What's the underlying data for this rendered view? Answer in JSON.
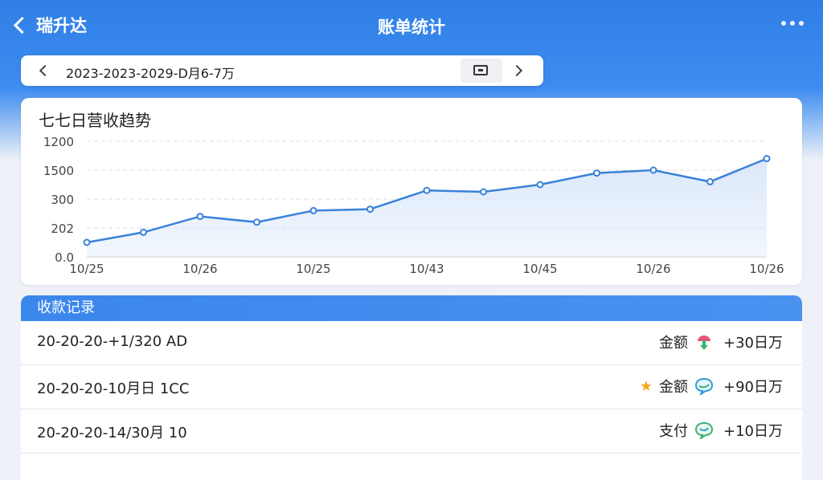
{
  "header": {
    "back_label": "瑞升达",
    "title": "账单统计"
  },
  "date_bar": {
    "range_text": "2023-2023-2029-D月6-7万"
  },
  "chart_card": {
    "title": "七七日营收趋势"
  },
  "chart_data": {
    "type": "area",
    "title": "七七日营收趋势",
    "y_tick_labels": [
      "0.0",
      "202",
      "300",
      "1500",
      "1200"
    ],
    "x_tick_labels": [
      "10/25",
      "10/26",
      "10/25",
      "10/43",
      "10/45",
      "10/26",
      "10/26"
    ],
    "series": [
      {
        "values": [
          0.5,
          0.85,
          1.4,
          1.2,
          1.6,
          1.65,
          2.3,
          2.25,
          2.5,
          2.9,
          3.0,
          2.6,
          3.4
        ]
      }
    ],
    "ylim": [
      0,
      4
    ],
    "grid": true,
    "legend": "none",
    "line_color": "#3a82d8",
    "fill_color": "#dbe8fa"
  },
  "records": {
    "header": "收款记录",
    "rows": [
      {
        "text": "20-20-20-+1/320 AD",
        "type_label": "金额",
        "icon": "pink-green-arrow-icon",
        "starred": false,
        "amount": "+30日万"
      },
      {
        "text": "20-20-20-10月日 1CC",
        "type_label": "金额",
        "icon": "blue-chat-icon",
        "starred": true,
        "amount": "+90日万"
      },
      {
        "text": "20-20-20-14/30月 10",
        "type_label": "支付",
        "icon": "green-chat-icon",
        "starred": false,
        "amount": "+10日万"
      }
    ]
  },
  "colors": {
    "accent": "#3a82d8",
    "header_blue": "#2f7fe6",
    "star": "#f5a623"
  }
}
